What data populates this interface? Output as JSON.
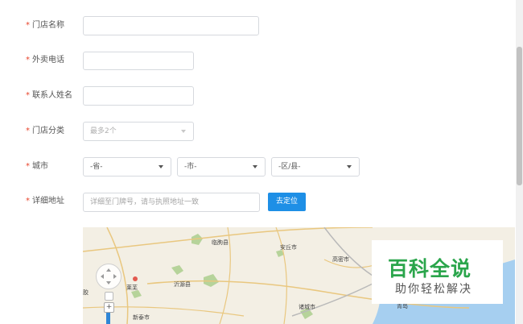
{
  "form": {
    "store_name": {
      "label": "门店名称",
      "value": ""
    },
    "delivery_phone": {
      "label": "外卖电话",
      "value": ""
    },
    "contact_name": {
      "label": "联系人姓名",
      "value": ""
    },
    "store_category": {
      "label": "门店分类",
      "placeholder": "最多2个"
    },
    "city": {
      "label": "城市",
      "province": "-省-",
      "city": "-市-",
      "district": "-区/县-"
    },
    "address": {
      "label": "详细地址",
      "placeholder": "详细至门牌号，请与执照地址一致",
      "locate_button": "去定位"
    }
  },
  "required_mark": "*",
  "map": {
    "labels": [
      "临朐县",
      "安丘市",
      "高密市",
      "莱芜",
      "沂源县",
      "诸城市",
      "新泰市",
      "青岛",
      "胶"
    ]
  },
  "watermark": {
    "title": "百科全说",
    "subtitle": "助你轻松解决"
  },
  "colors": {
    "primary": "#1e8fe6",
    "required": "#e8442b",
    "watermark": "#2aa54b"
  }
}
